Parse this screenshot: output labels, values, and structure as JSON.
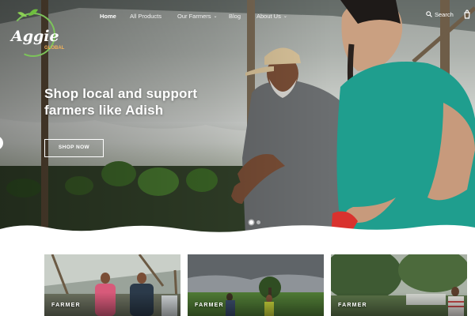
{
  "brand": {
    "logo_text": "Aggie",
    "logo_subtext": "GLOBAL",
    "logo_colors": {
      "script": "#ffffff",
      "sub": "#f2b35a",
      "ring": "#7cc35a",
      "leaf": "#6fbf3e"
    }
  },
  "nav": {
    "items": [
      {
        "label": "Home",
        "active": true
      },
      {
        "label": "All Products",
        "active": false
      },
      {
        "label": "Our Farmers",
        "active": false,
        "dropdown": true
      },
      {
        "label": "Blog",
        "active": false
      },
      {
        "label": "About Us",
        "active": false,
        "dropdown": true
      }
    ],
    "dropdown_glyph": "⌄",
    "search_label": "Search",
    "search_icon": "search-icon",
    "cart_icon": "cart-icon"
  },
  "hero": {
    "headline_line1": "Shop local and support",
    "headline_line2": "farmers like Adish",
    "cta_label": "SHOP NOW",
    "slide_count": 2,
    "active_slide": 1
  },
  "cards": [
    {
      "tag": "FARMER"
    },
    {
      "tag": "FARMER"
    },
    {
      "tag": "FARMER"
    }
  ],
  "colors": {
    "accent_green": "#1f9e8e",
    "white": "#ffffff"
  }
}
